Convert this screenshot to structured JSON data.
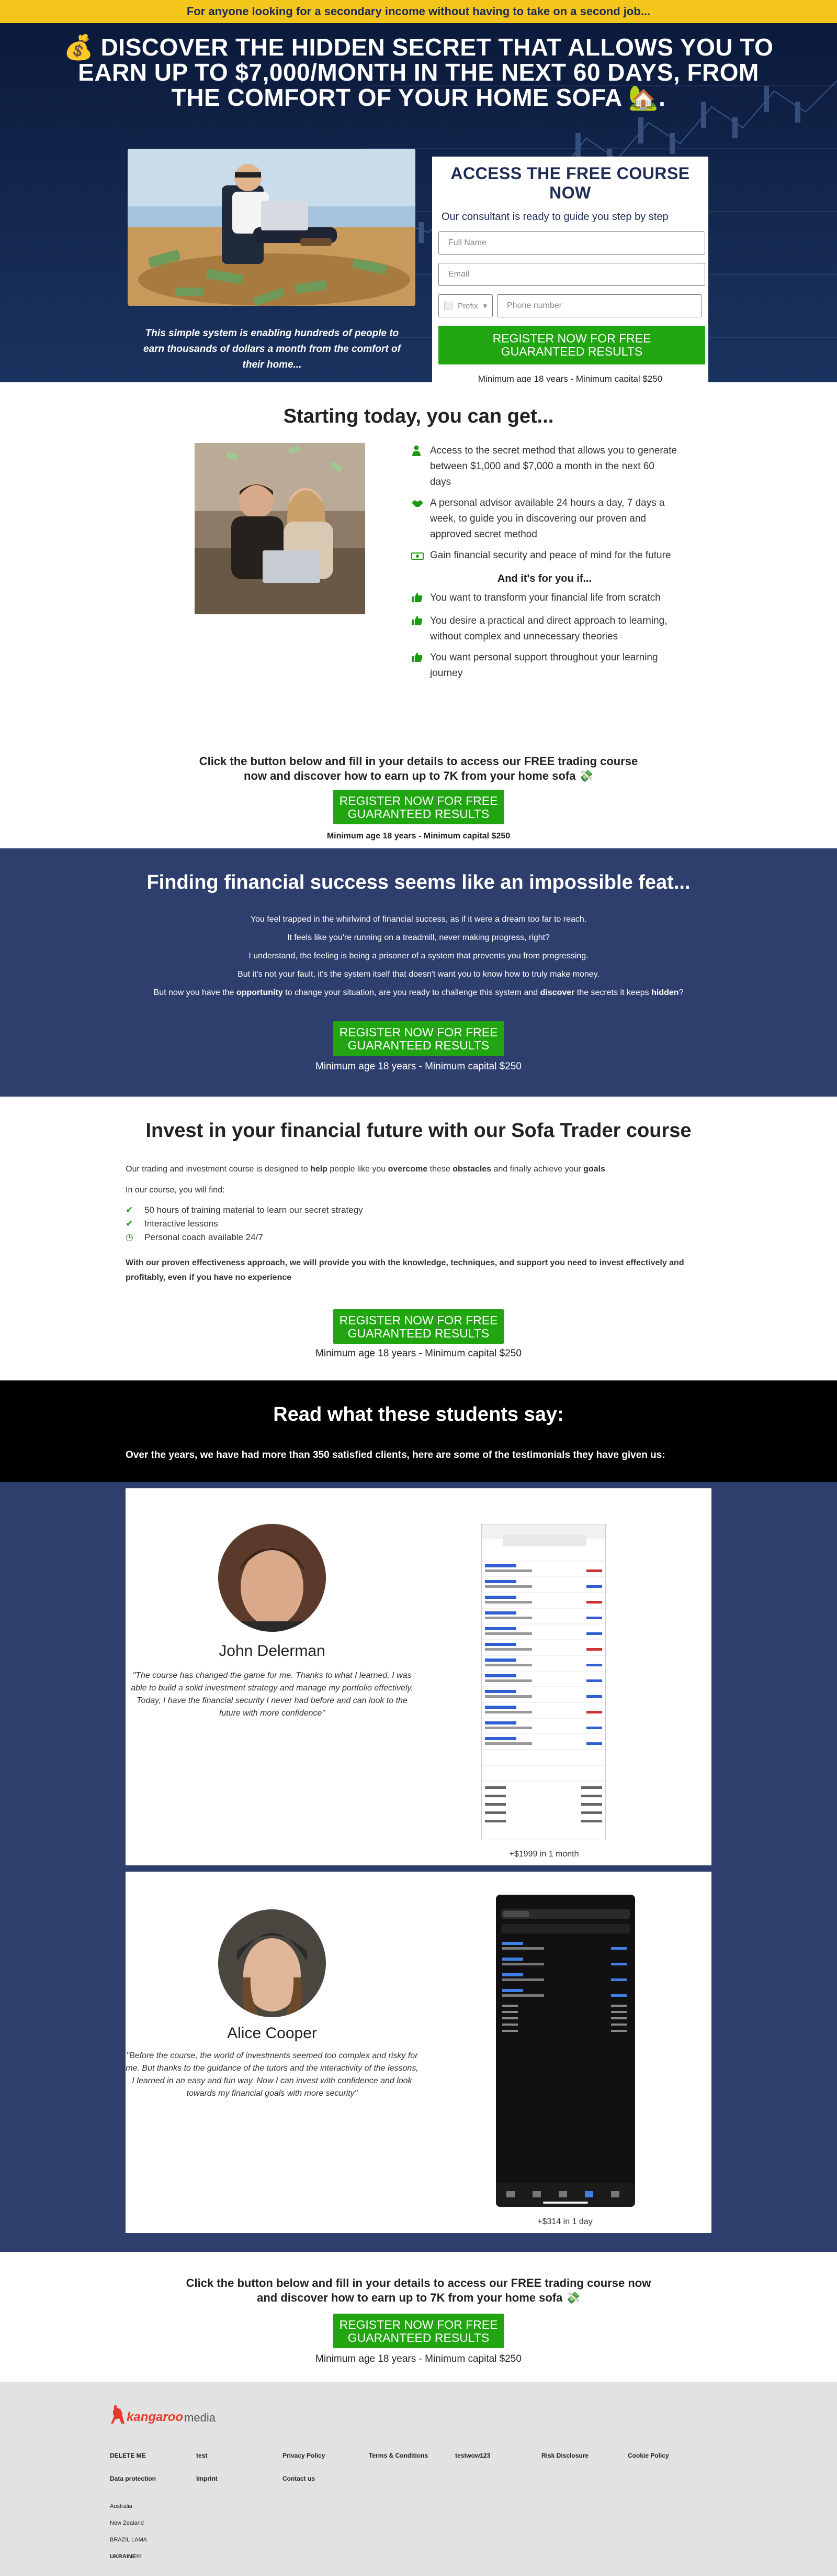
{
  "topbar": {
    "text": "For anyone looking for a secondary income without having to take on a second job..."
  },
  "hero": {
    "title_line1": "💰 DISCOVER THE HIDDEN SECRET THAT ALLOWS YOU TO",
    "title_line2": "EARN UP TO $7,000/MONTH IN THE NEXT 60 DAYS, FROM",
    "title_line3": "THE COMFORT OF YOUR HOME SOFA 🏡.",
    "caption": "This simple system is enabling hundreds of people to earn thousands of dollars a month from the comfort of their home..."
  },
  "form": {
    "title": "ACCESS THE FREE COURSE NOW",
    "subtitle": "Our consultant is ready to guide you step by step",
    "full_name_placeholder": "Full Name",
    "email_placeholder": "Email",
    "prefix_label": "Prefix",
    "phone_placeholder": "Phone number",
    "cta_line1": "REGISTER NOW FOR FREE",
    "cta_line2": "GUARANTEED RESULTS",
    "note": "Minimum age 18 years - Minimum capital $250"
  },
  "benefits": {
    "title": "Starting today, you can get...",
    "items": [
      "Access to the secret method that allows you to generate between $1,000 and $7,000 a month in the next 60 days",
      "A personal advisor available 24 hours a day, 7 days a week, to guide you in discovering our proven and approved secret method",
      "Gain financial security and peace of mind for the future"
    ],
    "for_you_title": "And it's for you if...",
    "for_you": [
      "You want to transform your financial life from scratch",
      "You desire a practical and direct approach to learning, without complex and unnecessary theories",
      "You want personal support throughout your learning journey"
    ],
    "cta_text_line1": "Click the button below and fill in your details to access our FREE trading course",
    "cta_text_line2": "now and discover how to earn up to 7K from your home sofa 💸",
    "cta_line1": "REGISTER NOW FOR FREE",
    "cta_line2": "GUARANTEED RESULTS",
    "note": "Minimum age 18 years - Minimum capital $250"
  },
  "struggle": {
    "title": "Finding financial success seems like an impossible feat...",
    "lines": [
      "You feel trapped in the whirlwind of financial success, as if it were a dream too far to reach.",
      "It feels like you're running on a treadmill, never making progress, right?",
      "I understand, the feeling is being a prisoner of a system that prevents you from progressing.",
      "But it's not your fault, it's the system itself that doesn't want you to know how to truly make money."
    ],
    "last_a": "But now you have the ",
    "last_b": "opportunity",
    "last_c": " to change your situation, are you ready to challenge this system and ",
    "last_d": "discover",
    "last_e": " the secrets it keeps ",
    "last_f": "hidden",
    "last_g": "?",
    "cta_line1": "REGISTER NOW FOR FREE",
    "cta_line2": "GUARANTEED RESULTS",
    "note": "Minimum age 18 years - Minimum capital $250"
  },
  "course": {
    "title": "Invest in your financial future with our Sofa Trader course",
    "intro_a": "Our trading and investment course is designed to ",
    "intro_b": "help",
    "intro_c": " people like you ",
    "intro_d": "overcome",
    "intro_e": " these ",
    "intro_f": "obstacles",
    "intro_g": " and finally achieve your ",
    "intro_h": "goals",
    "find": "In our course, you will find:",
    "items": [
      "50 hours of training material to learn our secret strategy",
      "Interactive lessons",
      "Personal coach available 24/7"
    ],
    "closing": "With our proven effectiveness approach, we will provide you with the knowledge, techniques, and support you need to invest effectively and profitably, even if you have no experience",
    "cta_line1": "REGISTER NOW FOR FREE",
    "cta_line2": "GUARANTEED RESULTS",
    "note": "Minimum age 18 years - Minimum capital $250"
  },
  "testimonials": {
    "title": "Read what these students say:",
    "subtitle": "Over the years, we have had more than 350 satisfied clients, here are some of the testimonials they have given us:",
    "items": [
      {
        "name": "John Delerman",
        "quote": "\"The course has changed the game for me. Thanks to what I learned, I was able to build a solid investment strategy and manage my portfolio effectively. Today, I have the financial security I never had before and can look to the future with more confidence\"",
        "caption": "+$1999 in 1 month"
      },
      {
        "name": "Alice Cooper",
        "quote": "\"Before the course, the world of investments seemed too complex and risky for me. But thanks to the guidance of the tutors and the interactivity of the lessons, I learned in an easy and fun way. Now I can invest with confidence and look towards my financial goals with more security\"",
        "caption": "+$314 in 1 day"
      }
    ]
  },
  "final_cta": {
    "line1": "Click the button below and fill in your details to access our FREE trading course now",
    "line2": "and discover how to earn up to 7K from your home sofa 💸",
    "cta_line1": "REGISTER NOW FOR FREE",
    "cta_line2": "GUARANTEED RESULTS",
    "note": "Minimum age 18 years - Minimum capital $250"
  },
  "footer": {
    "logo_a": "kangaroo",
    "logo_b": "media",
    "links": [
      "DELETE ME",
      "test",
      "Privacy Policy",
      "Terms & Conditions",
      "testwow123",
      "Risk Disclosure",
      "Cookie Policy",
      "Data protection",
      "Imprint",
      "Contact us"
    ],
    "countries": [
      "Australia",
      "New Zealand",
      "BRAZIL LAMA",
      "UKRAINE!!!"
    ]
  },
  "colors": {
    "accent_green": "#21a612",
    "navy": "#1e2b55",
    "yellow": "#f4c51a",
    "section_blue": "#2e3e6d"
  }
}
